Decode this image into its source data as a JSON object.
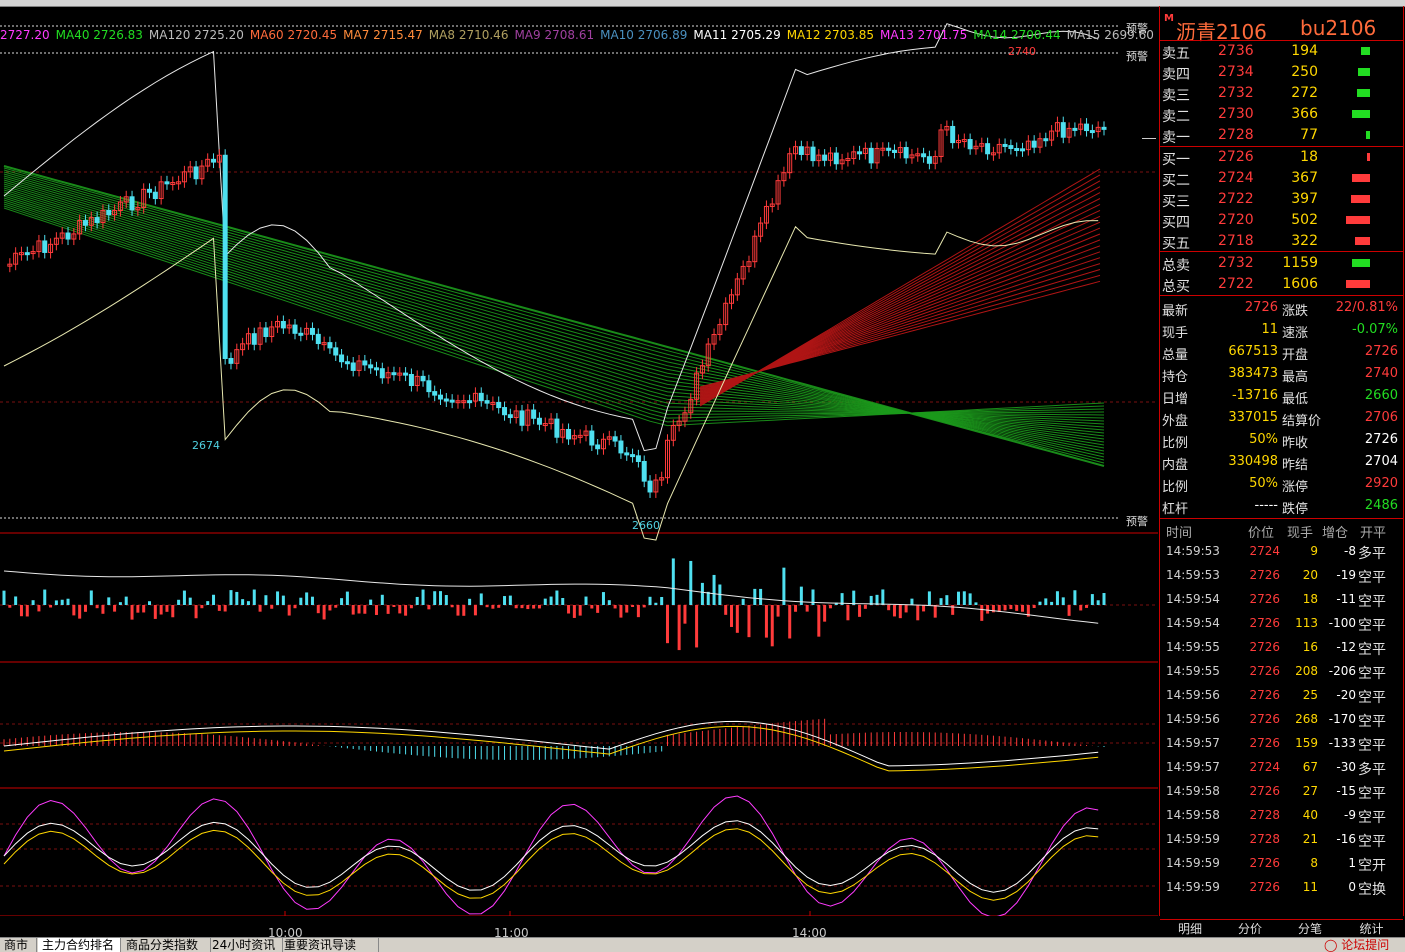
{
  "ma_bar": [
    {
      "label": "",
      "value": "2727.20",
      "color": "#ff3bff"
    },
    {
      "label": "MA40",
      "value": "2726.83",
      "color": "#22dd22"
    },
    {
      "label": "MA120",
      "value": "2725.20",
      "color": "#bbbbbb"
    },
    {
      "label": "MA60",
      "value": "2720.45",
      "color": "#ff6b3b"
    },
    {
      "label": "MA7",
      "value": "2715.47",
      "color": "#ff8c3b"
    },
    {
      "label": "MA8",
      "value": "2710.46",
      "color": "#b0a060"
    },
    {
      "label": "MA9",
      "value": "2708.61",
      "color": "#a040a0"
    },
    {
      "label": "MA10",
      "value": "2706.89",
      "color": "#4a90c0"
    },
    {
      "label": "MA11",
      "value": "2705.29",
      "color": "#ffffff"
    },
    {
      "label": "MA12",
      "value": "2703.85",
      "color": "#ffd700"
    },
    {
      "label": "MA13",
      "value": "2701.75",
      "color": "#ff3bff"
    },
    {
      "label": "MA14",
      "value": "2700.44",
      "color": "#22dd22"
    },
    {
      "label": "MA15",
      "value": "2699.60",
      "color": "#bbbbbb"
    }
  ],
  "warnings": [
    "预警",
    "预警",
    "预警"
  ],
  "price_labels": {
    "low1": "2674",
    "low2": "2660",
    "high": "2740"
  },
  "time_axis": [
    "10:00",
    "11:00",
    "14:00"
  ],
  "quote": {
    "name": "沥青2106",
    "code": "bu2106"
  },
  "asks": [
    {
      "label": "卖五",
      "price": "2736",
      "vol": "194",
      "level": 0.39
    },
    {
      "label": "卖四",
      "price": "2734",
      "vol": "250",
      "level": 0.5
    },
    {
      "label": "卖三",
      "price": "2732",
      "vol": "272",
      "level": 0.54
    },
    {
      "label": "卖二",
      "price": "2730",
      "vol": "366",
      "level": 0.73
    },
    {
      "label": "卖一",
      "price": "2728",
      "vol": "77",
      "level": 0.15
    }
  ],
  "bids": [
    {
      "label": "买一",
      "price": "2726",
      "vol": "18",
      "level": 0.04
    },
    {
      "label": "买二",
      "price": "2724",
      "vol": "367",
      "level": 0.73
    },
    {
      "label": "买三",
      "price": "2722",
      "vol": "397",
      "level": 0.79
    },
    {
      "label": "买四",
      "price": "2720",
      "vol": "502",
      "level": 1.0
    },
    {
      "label": "买五",
      "price": "2718",
      "vol": "322",
      "level": 0.64
    }
  ],
  "totals": [
    {
      "label": "总卖",
      "price": "2732",
      "vol": "1159",
      "level": 0.73,
      "color": "#22dd22"
    },
    {
      "label": "总买",
      "price": "2722",
      "vol": "1606",
      "level": 1.0,
      "color": "#ff3b3b"
    }
  ],
  "stats": [
    {
      "l1": "最新",
      "v1": "2726",
      "c1": "red",
      "l2": "涨跌",
      "v2": "22/0.81%",
      "c2": "red"
    },
    {
      "l1": "现手",
      "v1": "11",
      "c1": "yellow",
      "l2": "速涨",
      "v2": "-0.07%",
      "c2": "green"
    },
    {
      "l1": "总量",
      "v1": "667513",
      "c1": "yellow",
      "l2": "开盘",
      "v2": "2726",
      "c2": "red"
    },
    {
      "l1": "持仓",
      "v1": "383473",
      "c1": "yellow",
      "l2": "最高",
      "v2": "2740",
      "c2": "red"
    },
    {
      "l1": "日增",
      "v1": "-13716",
      "c1": "yellow",
      "l2": "最低",
      "v2": "2660",
      "c2": "green"
    },
    {
      "l1": "外盘",
      "v1": "337015",
      "c1": "yellow",
      "l2": "结算价",
      "v2": "2706",
      "c2": "red"
    },
    {
      "l1": "比例",
      "v1": "50%",
      "c1": "yellow",
      "l2": "昨收",
      "v2": "2726",
      "c2": "white"
    },
    {
      "l1": "内盘",
      "v1": "330498",
      "c1": "yellow",
      "l2": "昨结",
      "v2": "2704",
      "c2": "white"
    },
    {
      "l1": "比例",
      "v1": "50%",
      "c1": "yellow",
      "l2": "涨停",
      "v2": "2920",
      "c2": "red"
    },
    {
      "l1": "杠杆",
      "v1": "-----",
      "c1": "white",
      "l2": "跌停",
      "v2": "2486",
      "c2": "green"
    }
  ],
  "ticks_header": {
    "time": "时间",
    "price": "价位",
    "hand": "现手",
    "inc": "增仓",
    "kind": "开平"
  },
  "ticks": [
    {
      "time": "14:59:53",
      "price": "2724",
      "hand": "9",
      "inc": "-8",
      "kind": "多平"
    },
    {
      "time": "14:59:53",
      "price": "2726",
      "hand": "20",
      "inc": "-19",
      "kind": "空平"
    },
    {
      "time": "14:59:54",
      "price": "2726",
      "hand": "18",
      "inc": "-11",
      "kind": "空平"
    },
    {
      "time": "14:59:54",
      "price": "2726",
      "hand": "113",
      "inc": "-100",
      "kind": "空平"
    },
    {
      "time": "14:59:55",
      "price": "2726",
      "hand": "16",
      "inc": "-12",
      "kind": "空平"
    },
    {
      "time": "14:59:55",
      "price": "2726",
      "hand": "208",
      "inc": "-206",
      "kind": "空平"
    },
    {
      "time": "14:59:56",
      "price": "2726",
      "hand": "25",
      "inc": "-20",
      "kind": "空平"
    },
    {
      "time": "14:59:56",
      "price": "2726",
      "hand": "268",
      "inc": "-170",
      "kind": "空平"
    },
    {
      "time": "14:59:57",
      "price": "2726",
      "hand": "159",
      "inc": "-133",
      "kind": "空平"
    },
    {
      "time": "14:59:57",
      "price": "2724",
      "hand": "67",
      "inc": "-30",
      "kind": "多平"
    },
    {
      "time": "14:59:58",
      "price": "2726",
      "hand": "27",
      "inc": "-15",
      "kind": "空平"
    },
    {
      "time": "14:59:58",
      "price": "2728",
      "hand": "40",
      "inc": "-9",
      "kind": "空平"
    },
    {
      "time": "14:59:59",
      "price": "2728",
      "hand": "21",
      "inc": "-16",
      "kind": "空平"
    },
    {
      "time": "14:59:59",
      "price": "2726",
      "hand": "8",
      "inc": "1",
      "kind": "空开"
    },
    {
      "time": "14:59:59",
      "price": "2726",
      "hand": "11",
      "inc": "0",
      "kind": "空换"
    }
  ],
  "right_tabs": [
    "明细",
    "分价",
    "分笔",
    "统计"
  ],
  "bottom_tabs": [
    "商市",
    "主力合约排名",
    "商品分类指数",
    "24小时资讯",
    "重要资讯导读"
  ],
  "bottom_right": "论坛提问"
}
